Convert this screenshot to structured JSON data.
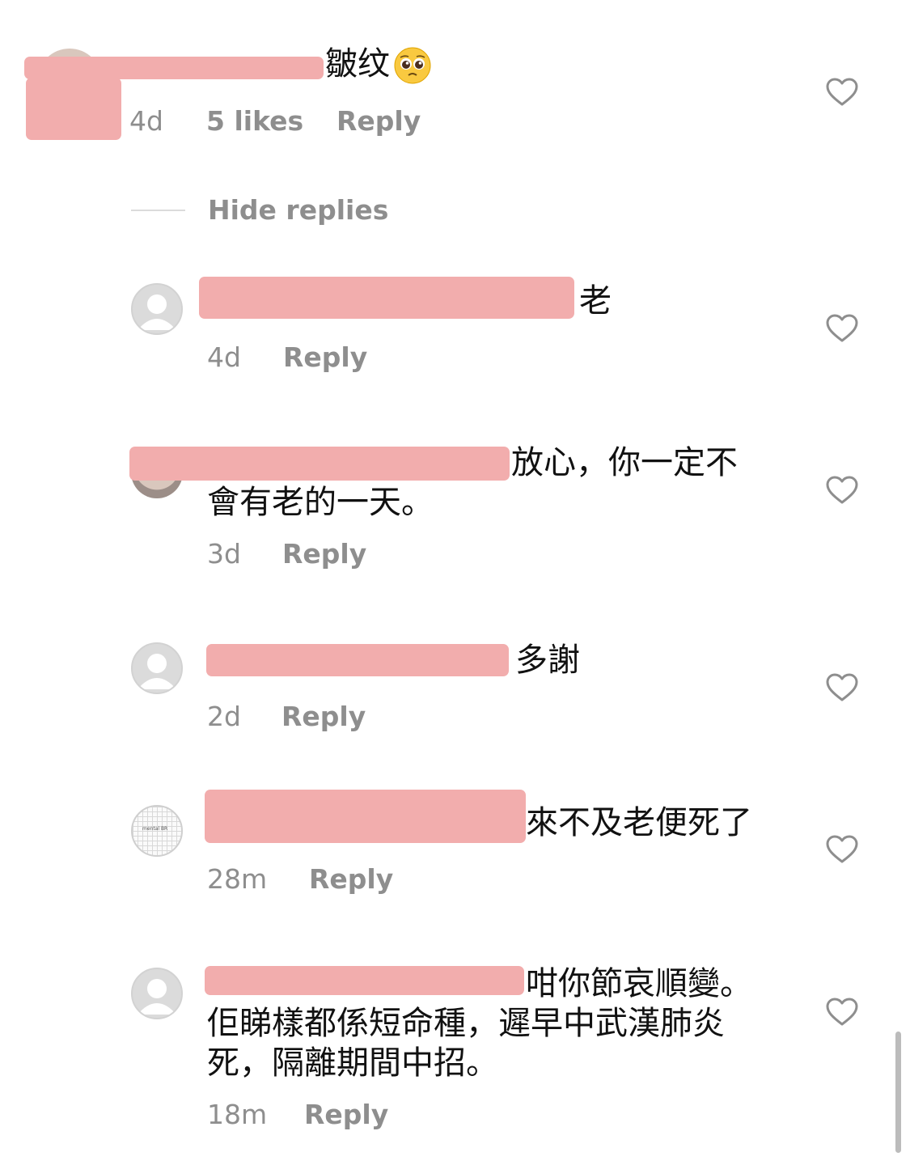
{
  "parent_comment": {
    "text": "皺纹",
    "emoji": "pleading-face-emoji",
    "time": "4d",
    "likes": "5 likes",
    "reply_label": "Reply"
  },
  "hide_replies_label": "Hide replies",
  "replies": [
    {
      "text": "老",
      "time": "4d",
      "reply_label": "Reply",
      "avatar": "default"
    },
    {
      "text_line1": "放心，你一定不",
      "text_line2": "會有老的一天。",
      "time": "3d",
      "reply_label": "Reply",
      "avatar": "photo"
    },
    {
      "text": "多謝",
      "time": "2d",
      "reply_label": "Reply",
      "avatar": "default"
    },
    {
      "text": "來不及老便死了",
      "time": "28m",
      "reply_label": "Reply",
      "avatar": "grid",
      "avatar_label": "mental BR"
    },
    {
      "text_line1": "咁你節哀順變。",
      "text_line2": "佢睇樣都係短命種，遲早中武漢肺炎",
      "text_line3": "死，隔離期間中招。",
      "time": "18m",
      "reply_label": "Reply",
      "avatar": "default"
    }
  ],
  "colors": {
    "redaction": "#f2adad",
    "meta_gray": "#8e8e8e",
    "text": "#111111",
    "icon_gray": "#8e8e8e"
  },
  "icons": {
    "like": "heart-outline-icon",
    "default_avatar": "default-user-avatar-icon"
  }
}
